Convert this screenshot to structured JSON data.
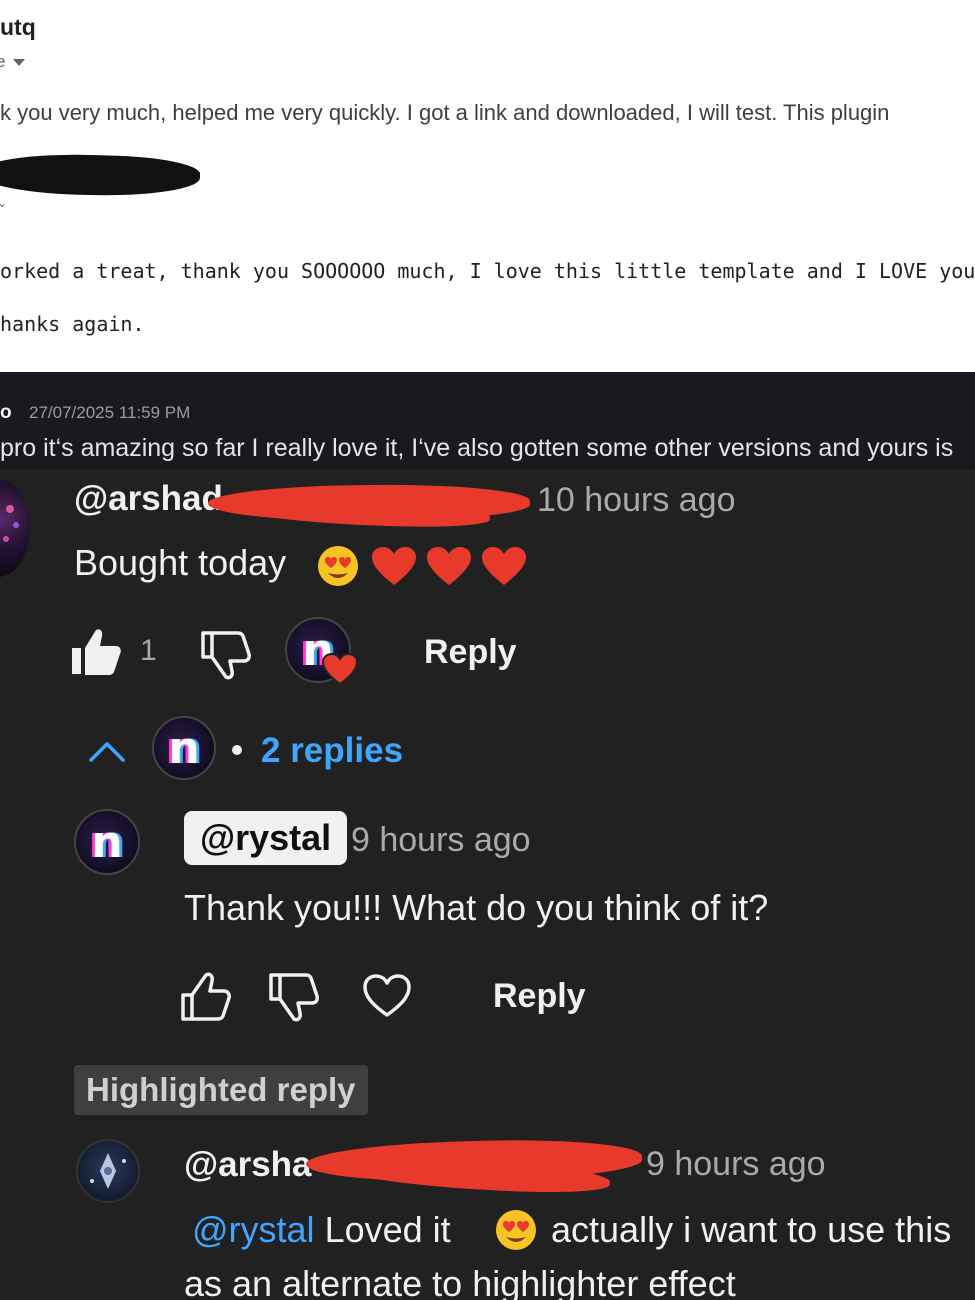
{
  "email": {
    "sender": "utq",
    "to_label": "e",
    "body": "k you very much, helped me very quickly. I got a link and downloaded, I will test. This plugin",
    "line1": "orked a treat, thank you SOOOOOO much, I love this little template and I LOVE your very",
    "line2": "hanks again."
  },
  "discord": {
    "username": "o",
    "timestamp": "27/07/2025 11:59 PM",
    "message": "pro it‘s amazing so far I really love it, I‘ve also gotten some other versions and yours is"
  },
  "youtube": {
    "comment": {
      "handle": "@arshad",
      "time": "10 hours ago",
      "text": "Bought today",
      "emojis": [
        "heart-eyes",
        "heart",
        "heart",
        "heart"
      ],
      "like_count": "1",
      "reply_label": "Reply"
    },
    "replies_toggle": {
      "label": "2 replies"
    },
    "reply1": {
      "handle": "@rystal",
      "time": "9 hours ago",
      "text": "Thank you!!! What do you think of it?",
      "reply_label": "Reply"
    },
    "highlighted_label": "Highlighted reply",
    "reply2": {
      "handle": "@arsha",
      "time": "9 hours ago",
      "mention": "@rystal",
      "text_a": "Loved it",
      "text_b": "actually i want to use this",
      "text_c": "as an alternate to highlighter effect"
    },
    "colors": {
      "background": "#212121",
      "accent_link": "#3ea6ff",
      "heart_red": "#e8392d"
    }
  }
}
